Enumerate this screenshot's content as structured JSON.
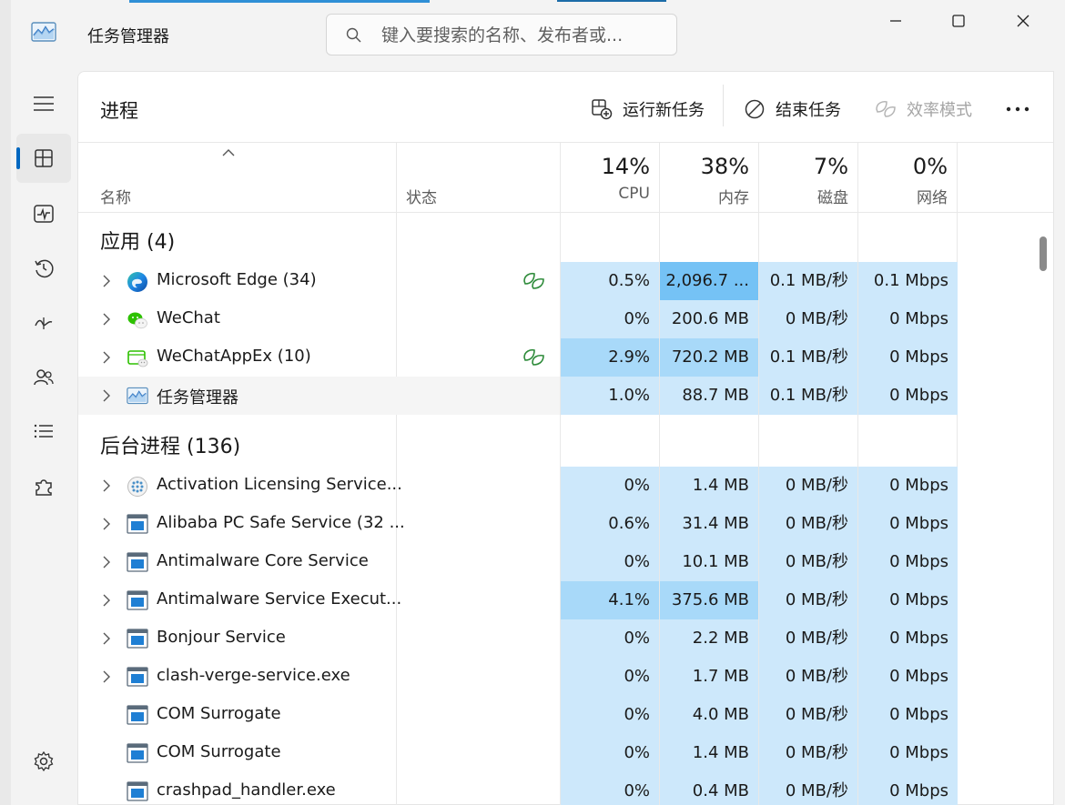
{
  "app": {
    "title": "任务管理器"
  },
  "search": {
    "placeholder": "键入要搜索的名称、发布者或..."
  },
  "page": {
    "title": "进程"
  },
  "commands": {
    "run_new_task": "运行新任务",
    "end_task": "结束任务",
    "efficiency_mode": "效率模式"
  },
  "columns": {
    "name": "名称",
    "status": "状态",
    "cpu": {
      "percent": "14%",
      "label": "CPU"
    },
    "memory": {
      "percent": "38%",
      "label": "内存"
    },
    "disk": {
      "percent": "7%",
      "label": "磁盘"
    },
    "network": {
      "percent": "0%",
      "label": "网络"
    }
  },
  "groups": [
    {
      "title": "应用 (4)",
      "rows": [
        {
          "name": "Microsoft Edge (34)",
          "icon": "edge-icon",
          "expandable": true,
          "efficiency": true,
          "cpu": "0.5%",
          "memory": "2,096.7 ...",
          "disk": "0.1 MB/秒",
          "network": "0.1 Mbps",
          "cpu_level": 1,
          "mem_level": 3
        },
        {
          "name": "WeChat",
          "icon": "wechat-icon",
          "expandable": true,
          "efficiency": false,
          "cpu": "0%",
          "memory": "200.6 MB",
          "disk": "0 MB/秒",
          "network": "0 Mbps",
          "cpu_level": 1,
          "mem_level": 1
        },
        {
          "name": "WeChatAppEx (10)",
          "icon": "wechatappex-icon",
          "expandable": true,
          "efficiency": true,
          "cpu": "2.9%",
          "memory": "720.2 MB",
          "disk": "0.1 MB/秒",
          "network": "0 Mbps",
          "cpu_level": 2,
          "mem_level": 2
        },
        {
          "name": "任务管理器",
          "icon": "task-manager-icon",
          "expandable": true,
          "efficiency": false,
          "cpu": "1.0%",
          "memory": "88.7 MB",
          "disk": "0.1 MB/秒",
          "network": "0 Mbps",
          "cpu_level": 1,
          "mem_level": 1,
          "hover": true
        }
      ]
    },
    {
      "title": "后台进程 (136)",
      "rows": [
        {
          "name": "Activation Licensing Service...",
          "icon": "activation-service-icon",
          "expandable": true,
          "efficiency": false,
          "cpu": "0%",
          "memory": "1.4 MB",
          "disk": "0 MB/秒",
          "network": "0 Mbps",
          "cpu_level": 1,
          "mem_level": 1
        },
        {
          "name": "Alibaba PC Safe Service (32 ...",
          "icon": "service-window-icon",
          "expandable": true,
          "efficiency": false,
          "cpu": "0.6%",
          "memory": "31.4 MB",
          "disk": "0 MB/秒",
          "network": "0 Mbps",
          "cpu_level": 1,
          "mem_level": 1
        },
        {
          "name": "Antimalware Core Service",
          "icon": "service-window-icon",
          "expandable": true,
          "efficiency": false,
          "cpu": "0%",
          "memory": "10.1 MB",
          "disk": "0 MB/秒",
          "network": "0 Mbps",
          "cpu_level": 1,
          "mem_level": 1
        },
        {
          "name": "Antimalware Service Execut...",
          "icon": "service-window-icon",
          "expandable": true,
          "efficiency": false,
          "cpu": "4.1%",
          "memory": "375.6 MB",
          "disk": "0 MB/秒",
          "network": "0 Mbps",
          "cpu_level": 2,
          "mem_level": 2
        },
        {
          "name": "Bonjour Service",
          "icon": "service-window-icon",
          "expandable": true,
          "efficiency": false,
          "cpu": "0%",
          "memory": "2.2 MB",
          "disk": "0 MB/秒",
          "network": "0 Mbps",
          "cpu_level": 1,
          "mem_level": 1
        },
        {
          "name": "clash-verge-service.exe",
          "icon": "service-window-icon",
          "expandable": true,
          "efficiency": false,
          "cpu": "0%",
          "memory": "1.7 MB",
          "disk": "0 MB/秒",
          "network": "0 Mbps",
          "cpu_level": 1,
          "mem_level": 1
        },
        {
          "name": "COM Surrogate",
          "icon": "service-window-icon",
          "expandable": false,
          "efficiency": false,
          "cpu": "0%",
          "memory": "4.0 MB",
          "disk": "0 MB/秒",
          "network": "0 Mbps",
          "cpu_level": 1,
          "mem_level": 1
        },
        {
          "name": "COM Surrogate",
          "icon": "service-window-icon",
          "expandable": false,
          "efficiency": false,
          "cpu": "0%",
          "memory": "1.4 MB",
          "disk": "0 MB/秒",
          "network": "0 Mbps",
          "cpu_level": 1,
          "mem_level": 1
        },
        {
          "name": "crashpad_handler.exe",
          "icon": "service-window-icon",
          "expandable": false,
          "efficiency": false,
          "cpu": "0%",
          "memory": "0.4 MB",
          "disk": "0 MB/秒",
          "network": "0 Mbps",
          "cpu_level": 1,
          "mem_level": 1
        }
      ]
    }
  ],
  "colors": {
    "heat1": "#cde8fb",
    "heat2": "#a8d9f9",
    "heat3": "#75c2f5",
    "accent": "#0067c0",
    "efficiency_leaf": "#2e8b3a"
  }
}
